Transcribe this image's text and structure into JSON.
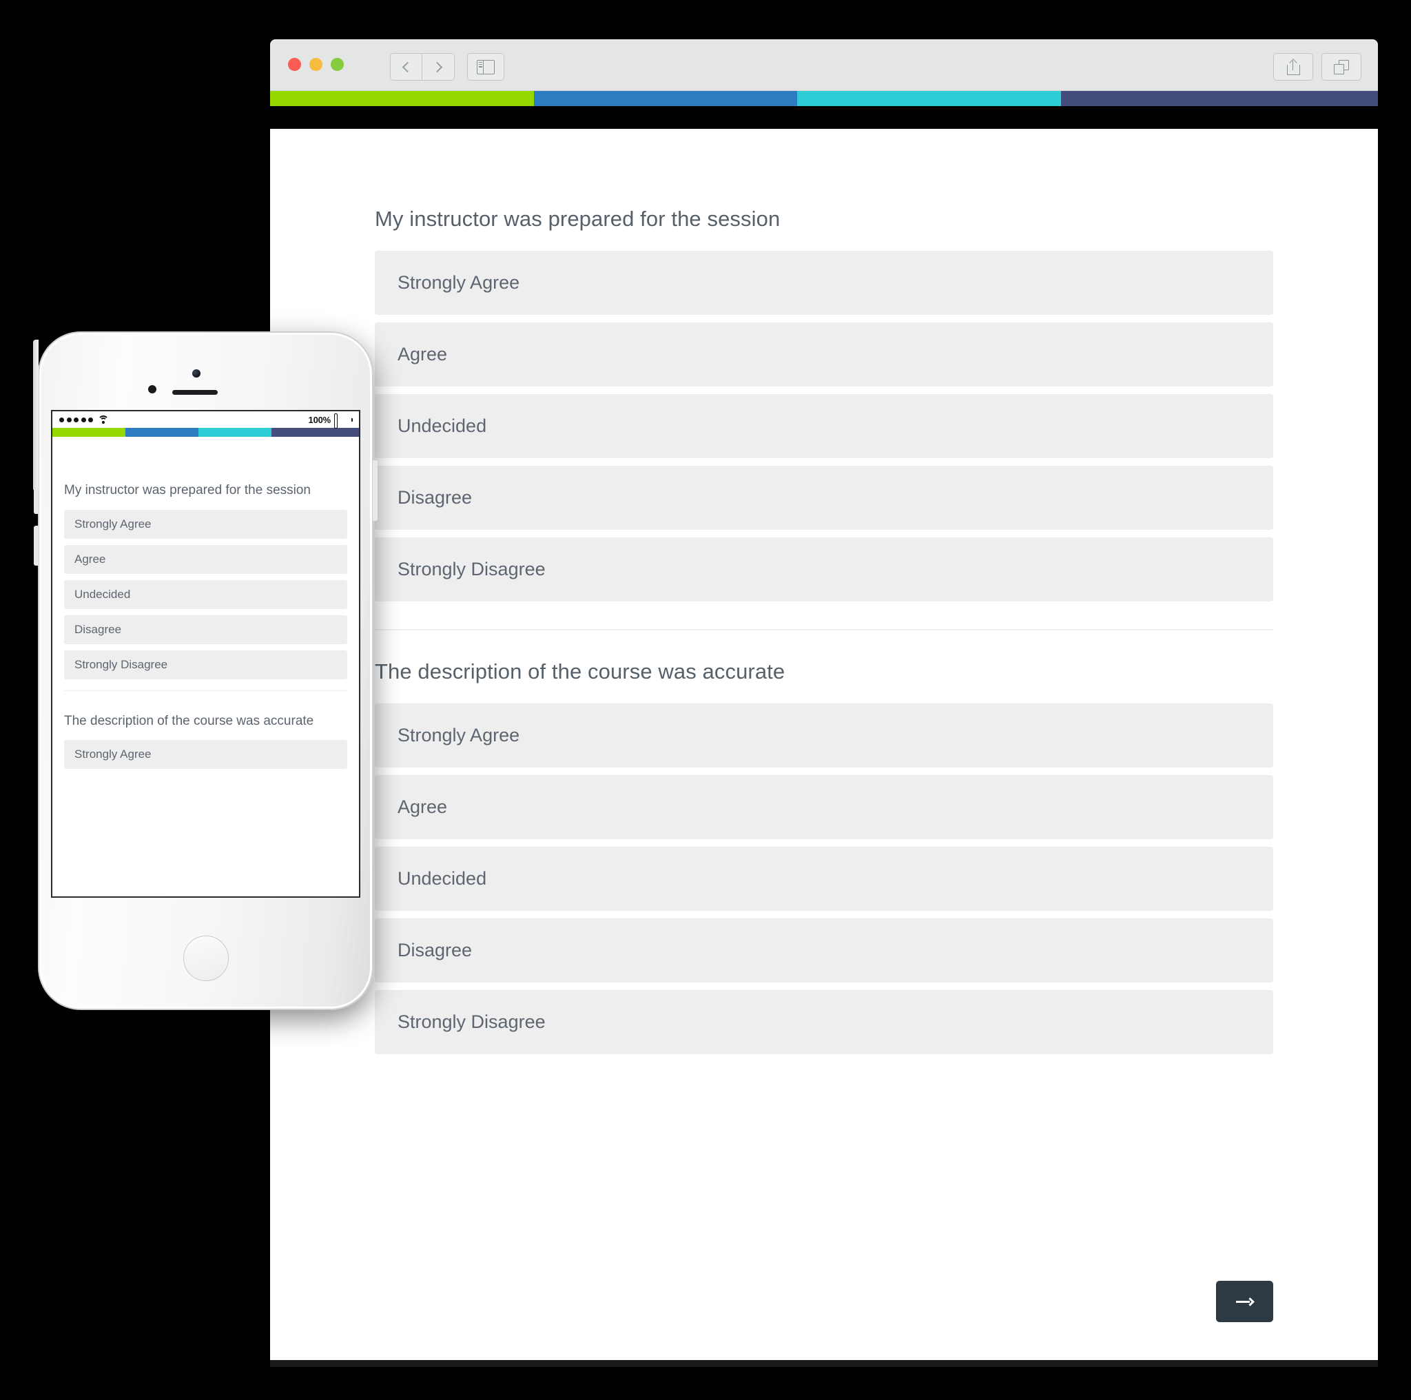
{
  "browser": {
    "traffic_lights": [
      {
        "name": "close",
        "color": "#f75c55"
      },
      {
        "name": "minimize",
        "color": "#f6bb3f"
      },
      {
        "name": "zoom",
        "color": "#87cb3e"
      }
    ],
    "nav_back_icon": "chevron-left-icon",
    "nav_forward_icon": "chevron-right-icon",
    "sidebar_icon": "sidebar-toggle-icon",
    "share_icon": "share-icon",
    "tabs_icon": "show-tabs-icon"
  },
  "brand_bar": {
    "segments": [
      {
        "name": "green",
        "color": "#97d700",
        "width_pct": 23.8
      },
      {
        "name": "blue",
        "color": "#2b7cc0",
        "width_pct": 23.8
      },
      {
        "name": "teal",
        "color": "#2eccd4",
        "width_pct": 23.8
      },
      {
        "name": "navy",
        "color": "#454d7d",
        "width_pct": 28.6
      }
    ]
  },
  "survey": {
    "questions": [
      {
        "title": "My instructor was prepared for the session",
        "options": [
          "Strongly Agree",
          "Agree",
          "Undecided",
          "Disagree",
          "Strongly Disagree"
        ]
      },
      {
        "title": "The description of the course was accurate",
        "options": [
          "Strongly Agree",
          "Agree",
          "Undecided",
          "Disagree",
          "Strongly Disagree"
        ]
      }
    ],
    "next_button": {
      "icon": "arrow-right-icon",
      "background": "#2d3943"
    }
  },
  "phone": {
    "status_bar": {
      "signal_dots": 5,
      "wifi_icon": "wifi-icon",
      "battery_percent": "100%",
      "battery_icon": "battery-full-icon"
    },
    "hardware": {
      "camera_icon": "front-camera-icon",
      "sensor_icon": "proximity-sensor-icon",
      "speaker_icon": "earpiece-speaker-icon",
      "home_button_icon": "home-button-icon"
    },
    "survey": {
      "questions": [
        {
          "title": "My instructor was prepared for the session",
          "options": [
            "Strongly Agree",
            "Agree",
            "Undecided",
            "Disagree",
            "Strongly Disagree"
          ]
        },
        {
          "title": "The description of the course was accurate",
          "options": [
            "Strongly Agree"
          ]
        }
      ]
    }
  }
}
